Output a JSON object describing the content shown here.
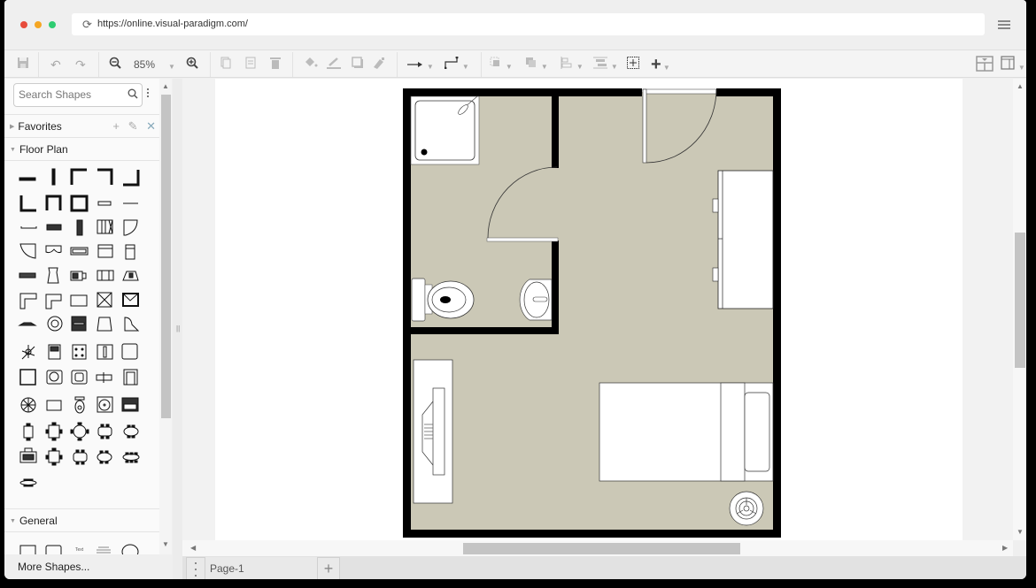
{
  "browser": {
    "url": "https://online.visual-paradigm.com/",
    "traffic_lights": {
      "close": "#e74c3c",
      "minimize": "#f5a623",
      "maximize": "#2ecc71"
    },
    "reload_icon": "reload-icon",
    "menu_icon": "hamburger-icon"
  },
  "toolbar": {
    "zoom_level": "85%",
    "items": [
      "save",
      "undo",
      "redo",
      "zoom-out",
      "zoom-level",
      "zoom-in",
      "copy",
      "paste",
      "delete",
      "fill-color",
      "line-color",
      "shadow",
      "format-painter",
      "connector-style",
      "waypoint-style",
      "to-front",
      "to-back",
      "align",
      "distribute",
      "select-all",
      "insert"
    ],
    "right_items": [
      "format-panel-toggle",
      "layout-panel"
    ]
  },
  "sidebar": {
    "search_placeholder": "Search Shapes",
    "sections": [
      {
        "label": "Favorites",
        "expanded": false,
        "actions": [
          "+",
          "✎",
          "✕"
        ]
      },
      {
        "label": "Floor Plan",
        "expanded": true
      },
      {
        "label": "General",
        "expanded": true
      }
    ],
    "more_shapes": "More Shapes..."
  },
  "canvas": {
    "floorplan_colors": {
      "floor": "#cbc8b6",
      "wall": "#000000",
      "fixture": "#ffffff"
    },
    "objects": [
      "shower",
      "bathroom-door",
      "entry-door",
      "toilet",
      "bathroom-sink",
      "wardrobe",
      "desk-with-chair",
      "bed",
      "plant"
    ]
  },
  "pages": {
    "tabs": [
      "Page-1"
    ],
    "active": "Page-1",
    "add_label": "+"
  }
}
